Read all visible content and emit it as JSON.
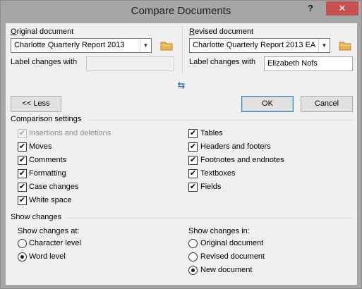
{
  "dialog": {
    "title": "Compare Documents",
    "help_label": "?",
    "close_label": "✕"
  },
  "original": {
    "heading": "Original document",
    "selected": "Charlotte Quarterly Report 2013",
    "label_changes_text": "Label changes with",
    "label_value": ""
  },
  "revised": {
    "heading": "Revised document",
    "selected": "Charlotte Quarterly Report 2013 EA",
    "label_changes_text": "Label changes with",
    "label_value": "Elizabeth Nofs"
  },
  "buttons": {
    "less": "<< Less",
    "ok": "OK",
    "cancel": "Cancel"
  },
  "comparison": {
    "heading": "Comparison settings",
    "left": [
      {
        "label": "Insertions and deletions",
        "checked": true,
        "disabled": true
      },
      {
        "label": "Moves",
        "checked": true,
        "disabled": false
      },
      {
        "label": "Comments",
        "checked": true,
        "disabled": false
      },
      {
        "label": "Formatting",
        "checked": true,
        "disabled": false
      },
      {
        "label": "Case changes",
        "checked": true,
        "disabled": false
      },
      {
        "label": "White space",
        "checked": true,
        "disabled": false
      }
    ],
    "right": [
      {
        "label": "Tables",
        "checked": true
      },
      {
        "label": "Headers and footers",
        "checked": true
      },
      {
        "label": "Footnotes and endnotes",
        "checked": true
      },
      {
        "label": "Textboxes",
        "checked": true
      },
      {
        "label": "Fields",
        "checked": true
      }
    ]
  },
  "show_changes": {
    "heading": "Show changes",
    "at": {
      "heading": "Show changes at:",
      "options": [
        {
          "label": "Character level",
          "selected": false
        },
        {
          "label": "Word level",
          "selected": true
        }
      ]
    },
    "in": {
      "heading": "Show changes in:",
      "options": [
        {
          "label": "Original document",
          "selected": false
        },
        {
          "label": "Revised document",
          "selected": false
        },
        {
          "label": "New document",
          "selected": true
        }
      ]
    }
  },
  "icons": {
    "check": "✔",
    "dropdown": "▼",
    "swap": "⇆"
  },
  "colors": {
    "title_bar": "#a6a6a6",
    "close_button": "#c75050",
    "client_bg": "#f0f0f0",
    "swap_icon": "#2f6fb4",
    "folder_icon": "#e8b64c"
  }
}
